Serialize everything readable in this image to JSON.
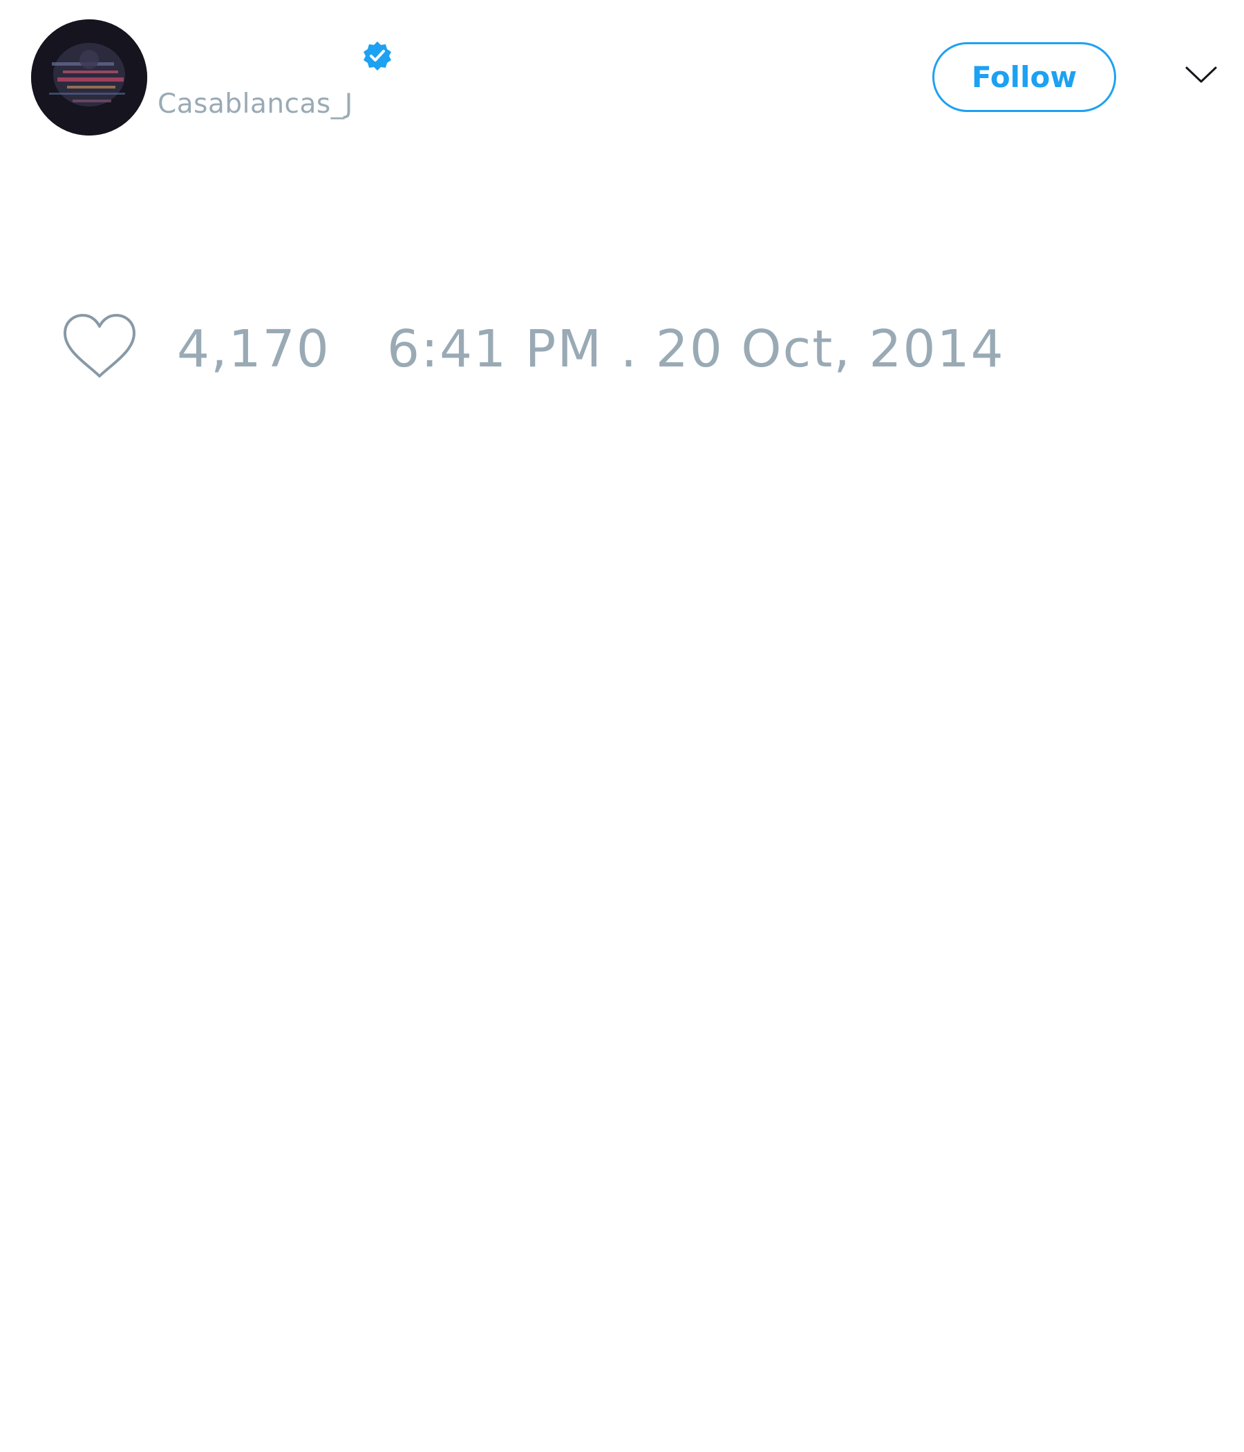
{
  "tweet": {
    "author": {
      "username": "Casablancas_J",
      "verified": true,
      "avatar_icon": "avatar-photo"
    },
    "follow_button": {
      "label": "Follow"
    },
    "menu_icon": "chevron-down-icon",
    "likes": {
      "icon": "heart-icon",
      "count": "4,170"
    },
    "timestamp": "6:41 PM . 20 Oct, 2014"
  },
  "colors": {
    "accent": "#1da1f2",
    "muted_text": "#99aab5",
    "icon_gray": "#8899a6",
    "background": "#ffffff"
  }
}
